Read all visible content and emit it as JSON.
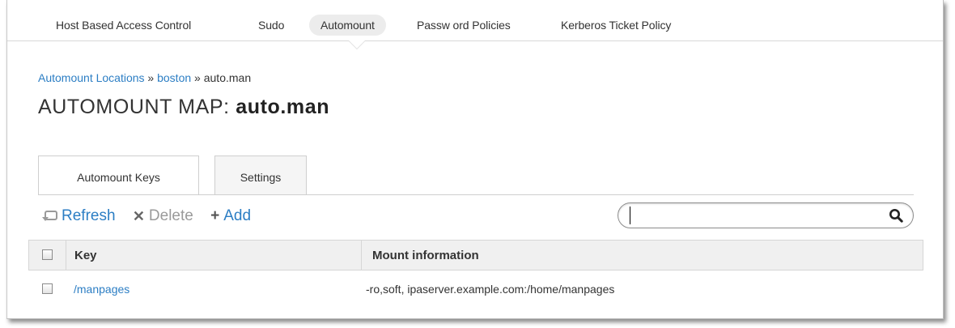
{
  "nav": {
    "items": [
      {
        "label": "Host Based Access Control",
        "active": false
      },
      {
        "label": "Sudo",
        "active": false
      },
      {
        "label": "Automount",
        "active": true
      },
      {
        "label": "Passw ord Policies",
        "active": false
      },
      {
        "label": "Kerberos Ticket Policy",
        "active": false
      }
    ]
  },
  "breadcrumb": {
    "link1": "Automount Locations",
    "sep1": "»",
    "link2": "boston",
    "sep2": "»",
    "current": "auto.man"
  },
  "title": {
    "prefix": "AUTOMOUNT MAP:",
    "name": "auto.man"
  },
  "tabs": [
    {
      "label": "Automount Keys",
      "active": true
    },
    {
      "label": "Settings",
      "active": false
    }
  ],
  "actions": {
    "refresh": "Refresh",
    "delete": "Delete",
    "add": "Add"
  },
  "search": {
    "value": "",
    "placeholder": ""
  },
  "table": {
    "columns": [
      "Key",
      "Mount information"
    ],
    "rows": [
      {
        "key": "/manpages",
        "info": "-ro,soft, ipaserver.example.com:/home/manpages"
      }
    ]
  },
  "colors": {
    "link": "#2c7ec4",
    "active_tab_bg": "#ececec"
  },
  "icons": {
    "refresh": "refresh-icon",
    "delete": "x-icon",
    "add": "plus-icon",
    "search": "magnifier-icon"
  }
}
